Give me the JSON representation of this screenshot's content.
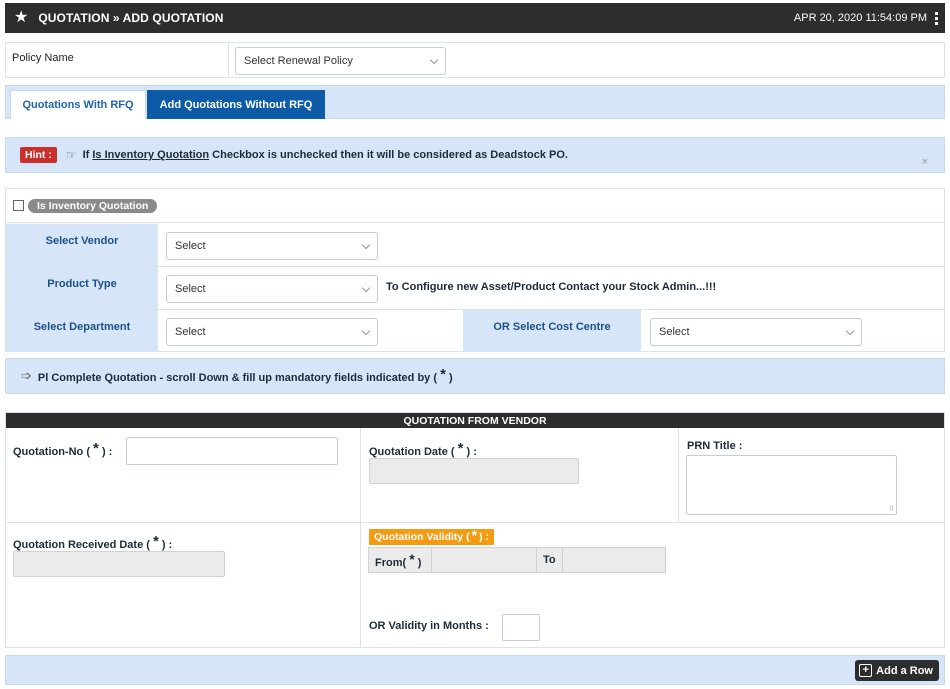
{
  "header": {
    "title": "QUOTATION » ADD QUOTATION",
    "datetime": "APR 20, 2020  11:54:09 PM",
    "star_icon": "star-icon",
    "menu_icon": "kebab-menu-icon"
  },
  "policy": {
    "label": "Policy Name",
    "select_value": "Select Renewal Policy"
  },
  "tabs": [
    {
      "label": "Quotations With RFQ",
      "active": false
    },
    {
      "label": "Add Quotations Without RFQ",
      "active": true
    }
  ],
  "hint": {
    "badge": "Hint :",
    "icon": "pointing-hand-icon",
    "prefix": "If ",
    "link": "Is Inventory Quotation",
    "suffix": " Checkbox is unchecked then it will be considered as Deadstock PO.",
    "close": "×"
  },
  "inventory": {
    "checkbox_label": "Is Inventory Quotation",
    "checked": false
  },
  "vendor_form": {
    "vendor_label": "Select Vendor",
    "vendor_value": "Select",
    "product_type_label": "Product Type",
    "product_type_value": "Select",
    "product_info": "To Configure new Asset/Product Contact your Stock Admin...!!!",
    "department_label": "Select Department",
    "department_value": "Select",
    "cost_centre_label": "OR Select Cost Centre",
    "cost_centre_value": "Select"
  },
  "notice": {
    "icon": "arrow-right-icon",
    "text": "Pl Complete Quotation - scroll Down & fill up mandatory fields indicated by (",
    "star": "*",
    "close_paren": ")"
  },
  "quotation_from_vendor": {
    "heading": "QUOTATION FROM VENDOR",
    "quotation_no_label": "Quotation-No (",
    "quotation_no_value": "",
    "quotation_date_label": "Quotation Date (",
    "prn_title_label": "PRN Title :",
    "received_date_label": "Quotation Received Date (",
    "validity_label": "Quotation Validity (",
    "from_label": "From(",
    "to_label": "To",
    "validity_months_label": "OR   Validity in Months :",
    "star": "*",
    "close_colon": ") :",
    "close_paren": ")"
  },
  "footer": {
    "add_row_label": "Add a Row",
    "add_icon": "plus-square-icon"
  },
  "colors": {
    "dark_header": "#2d2d2d",
    "panel_blue": "#d6e6f8",
    "active_tab": "#0d5aa7",
    "hint_badge": "#c9302c",
    "validity_badge": "#f39c12"
  }
}
